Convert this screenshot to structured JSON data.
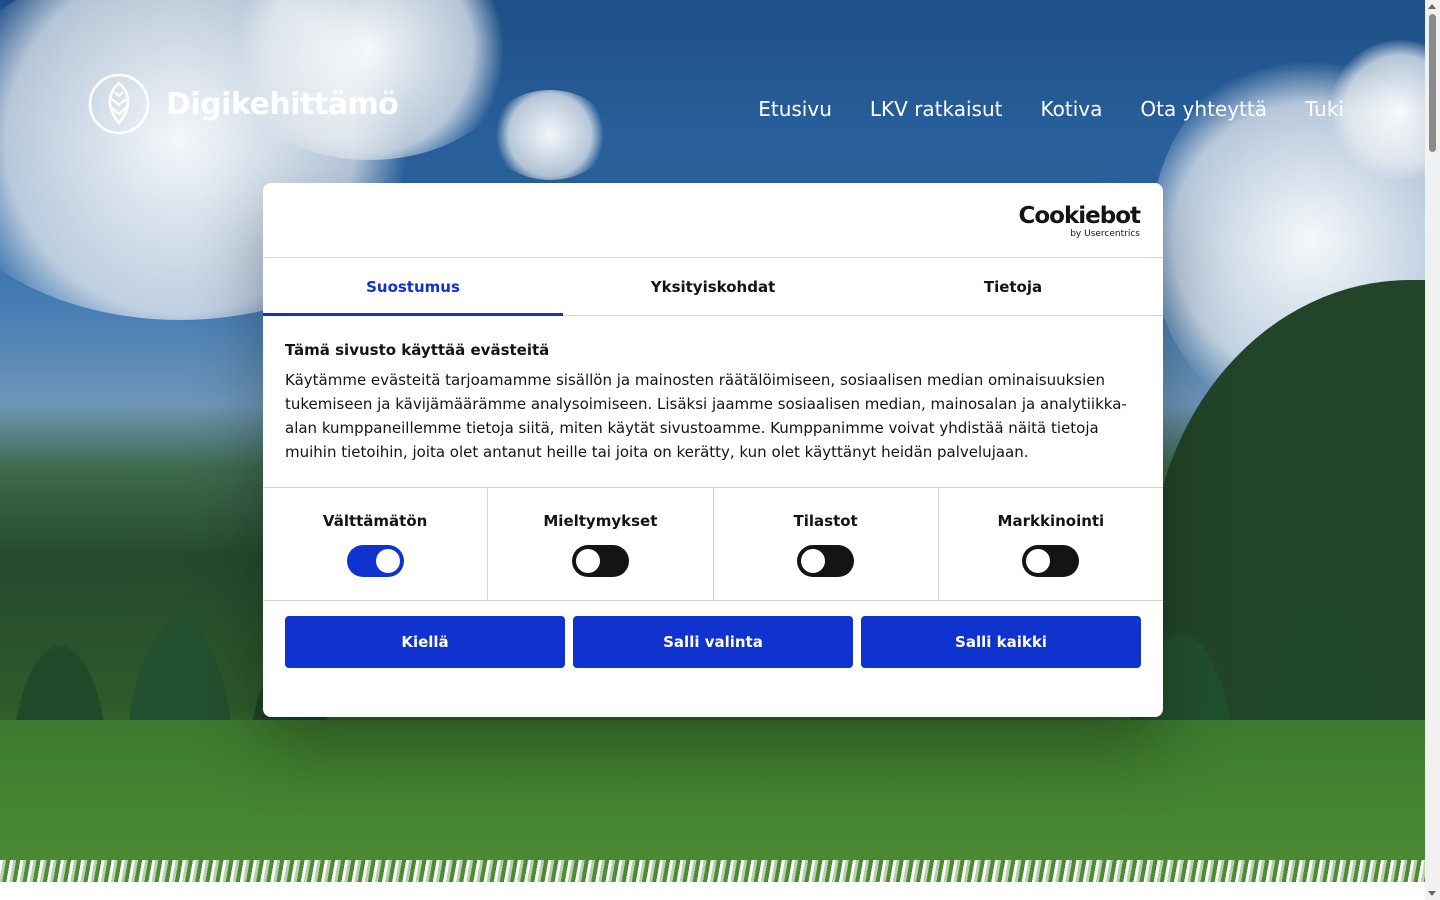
{
  "site": {
    "logo_text": "Digikehittämö",
    "nav": [
      "Etusivu",
      "LKV ratkaisut",
      "Kotiva",
      "Ota yhteyttä",
      "Tuki"
    ]
  },
  "dialog": {
    "brand_name": "Cookiebot",
    "brand_sub": "by Usercentrics",
    "tabs": [
      "Suostumus",
      "Yksityiskohdat",
      "Tietoja"
    ],
    "active_tab": "Suostumus",
    "heading": "Tämä sivusto käyttää evästeitä",
    "description": "Käytämme evästeitä tarjoamamme sisällön ja mainosten räätälöimiseen, sosiaalisen median ominaisuuksien tukemiseen ja kävijämäärämme analysoimiseen. Lisäksi jaamme sosiaalisen median, mainosalan ja analytiikka-alan kumppaneillemme tietoja siitä, miten käytät sivustoamme. Kumppanimme voivat yhdistää näitä tietoja muihin tietoihin, joita olet antanut heille tai joita on kerätty, kun olet käyttänyt heidän palvelujaan.",
    "toggles": [
      {
        "label": "Välttämätön",
        "on": true
      },
      {
        "label": "Mieltymykset",
        "on": false
      },
      {
        "label": "Tilastot",
        "on": false
      },
      {
        "label": "Markkinointi",
        "on": false
      }
    ],
    "buttons": [
      "Kiellä",
      "Salli valinta",
      "Salli kaikki"
    ]
  },
  "colors": {
    "accent": "#1032cf",
    "text": "#141414"
  }
}
